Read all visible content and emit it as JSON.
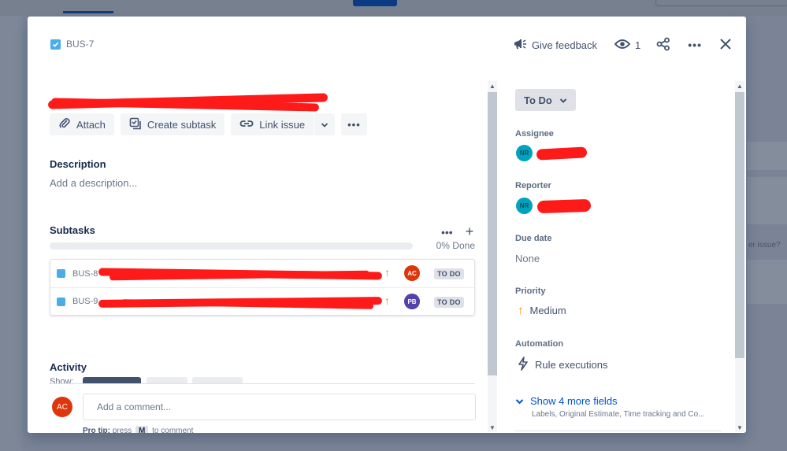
{
  "background": {
    "side_text": "er issue?"
  },
  "modal": {
    "issue_key": "BUS-7",
    "summary": "",
    "header": {
      "feedback_label": "Give feedback",
      "watch_count": "1",
      "more_glyph": "•••",
      "close_glyph": "✕"
    },
    "toolbar": {
      "attach": "Attach",
      "create_subtask": "Create subtask",
      "link_issue": "Link issue",
      "more": "•••"
    },
    "description": {
      "title": "Description",
      "placeholder": "Add a description..."
    },
    "subtasks": {
      "title": "Subtasks",
      "progress_label": "0% Done",
      "progress_fraction": 0,
      "tools_more": "•••",
      "tools_add": "+",
      "items": [
        {
          "key": "BUS-8",
          "summary": "",
          "avatar": "AC",
          "avatar_color": "#de350b",
          "status": "TO DO",
          "priority": "medium"
        },
        {
          "key": "BUS-9",
          "summary": "",
          "avatar": "PB",
          "avatar_color": "#5243aa",
          "status": "TO DO",
          "priority": "medium"
        }
      ]
    },
    "activity": {
      "title": "Activity",
      "show_label": "Show:"
    },
    "comment": {
      "avatar": "AC",
      "placeholder": "Add a comment...",
      "protip_bold": "Pro tip:",
      "protip_pre": "press",
      "protip_key": "M",
      "protip_post": "to comment"
    },
    "sidebar": {
      "status": "To Do",
      "assignee_label": "Assignee",
      "assignee_avatar": "NR",
      "reporter_label": "Reporter",
      "reporter_avatar": "NR",
      "due_date_label": "Due date",
      "due_date_value": "None",
      "priority_label": "Priority",
      "priority_value": "Medium",
      "automation_label": "Automation",
      "automation_value": "Rule executions",
      "show_more": "Show 4 more fields",
      "show_more_sub": "Labels, Original Estimate, Time tracking and Co..."
    }
  },
  "colors": {
    "accent": "#0052cc",
    "priority_medium": "#ff8b00",
    "redaction": "#ff1a1a"
  }
}
